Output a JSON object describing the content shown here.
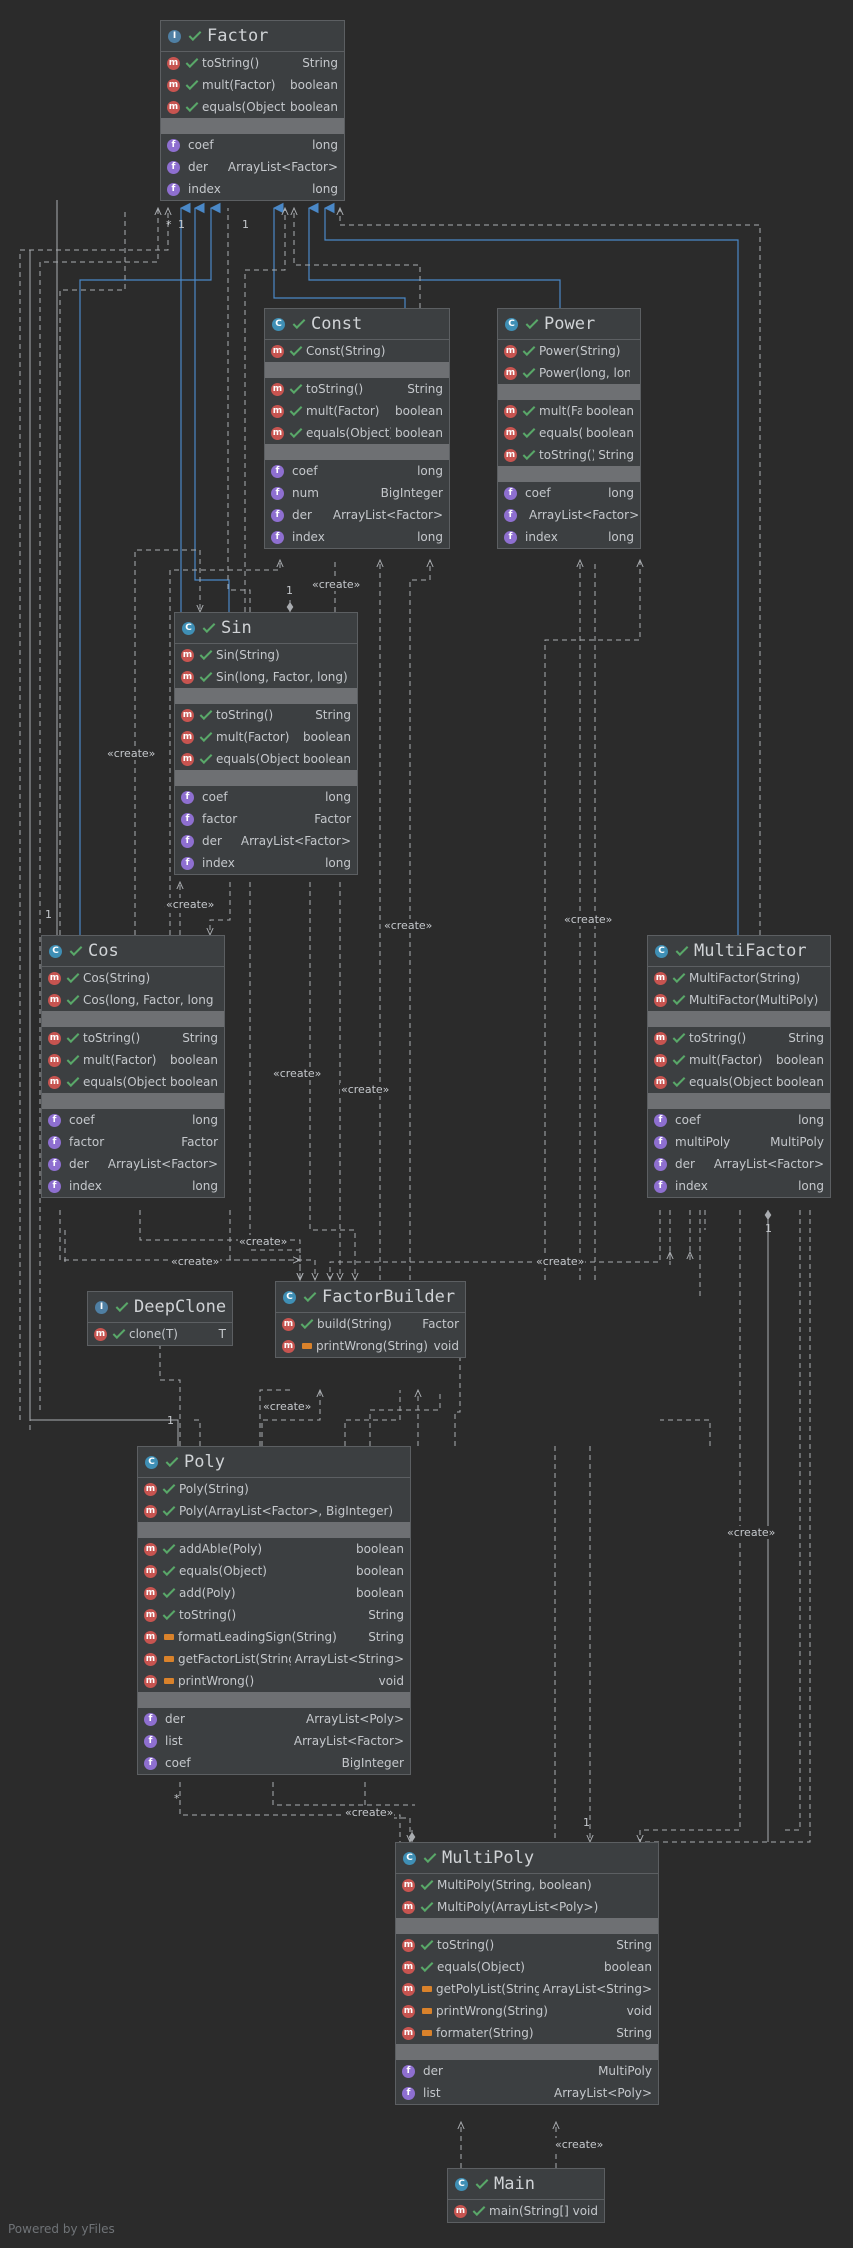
{
  "classes": [
    {
      "id": "factor",
      "name": "Factor",
      "kind": "i",
      "methods": [
        {
          "b": "m",
          "v": "pub",
          "n": "toString()",
          "t": "String",
          "abstract": true
        },
        {
          "b": "m",
          "v": "pub",
          "n": "mult(Factor)",
          "t": "boolean",
          "abstract": true
        },
        {
          "b": "m",
          "v": "pub",
          "n": "equals(Object)",
          "t": "boolean",
          "abstract": true
        }
      ],
      "fields": [
        {
          "b": "f",
          "v": "none",
          "n": "coef",
          "t": "long"
        },
        {
          "b": "f",
          "v": "none",
          "n": "der",
          "t": "ArrayList<Factor>"
        },
        {
          "b": "f",
          "v": "none",
          "n": "index",
          "t": "long"
        }
      ]
    },
    {
      "id": "const",
      "name": "Const",
      "kind": "c",
      "ctors": [
        {
          "b": "m",
          "v": "pub",
          "n": "Const(String)",
          "t": ""
        }
      ],
      "methods": [
        {
          "b": "m",
          "v": "pub",
          "n": "toString()",
          "t": "String"
        },
        {
          "b": "m",
          "v": "pub",
          "n": "mult(Factor)",
          "t": "boolean"
        },
        {
          "b": "m",
          "v": "pub",
          "n": "equals(Object)",
          "t": "boolean"
        }
      ],
      "fields": [
        {
          "b": "f",
          "v": "none",
          "n": "coef",
          "t": "long"
        },
        {
          "b": "f",
          "v": "none",
          "n": "num",
          "t": "BigInteger"
        },
        {
          "b": "f",
          "v": "none",
          "n": "der",
          "t": "ArrayList<Factor>"
        },
        {
          "b": "f",
          "v": "none",
          "n": "index",
          "t": "long"
        }
      ]
    },
    {
      "id": "power",
      "name": "Power",
      "kind": "c",
      "ctors": [
        {
          "b": "m",
          "v": "pub",
          "n": "Power(String)",
          "t": ""
        },
        {
          "b": "m",
          "v": "pub",
          "n": "Power(long, long)",
          "t": ""
        }
      ],
      "methods": [
        {
          "b": "m",
          "v": "pub",
          "n": "mult(Factor)",
          "t": "boolean"
        },
        {
          "b": "m",
          "v": "pub",
          "n": "equals(Object)",
          "t": "boolean"
        },
        {
          "b": "m",
          "v": "pub",
          "n": "toString()",
          "t": "String"
        }
      ],
      "fields": [
        {
          "b": "f",
          "v": "none",
          "n": "coef",
          "t": "long"
        },
        {
          "b": "f",
          "v": "none",
          "n": "der",
          "t": "ArrayList<Factor>"
        },
        {
          "b": "f",
          "v": "none",
          "n": "index",
          "t": "long"
        }
      ]
    },
    {
      "id": "sin",
      "name": "Sin",
      "kind": "c",
      "ctors": [
        {
          "b": "m",
          "v": "pub",
          "n": "Sin(String)",
          "t": ""
        },
        {
          "b": "m",
          "v": "pub",
          "n": "Sin(long, Factor, long)",
          "t": ""
        }
      ],
      "methods": [
        {
          "b": "m",
          "v": "pub",
          "n": "toString()",
          "t": "String"
        },
        {
          "b": "m",
          "v": "pub",
          "n": "mult(Factor)",
          "t": "boolean"
        },
        {
          "b": "m",
          "v": "pub",
          "n": "equals(Object)",
          "t": "boolean"
        }
      ],
      "fields": [
        {
          "b": "f",
          "v": "none",
          "n": "coef",
          "t": "long"
        },
        {
          "b": "f",
          "v": "none",
          "n": "factor",
          "t": "Factor"
        },
        {
          "b": "f",
          "v": "none",
          "n": "der",
          "t": "ArrayList<Factor>"
        },
        {
          "b": "f",
          "v": "none",
          "n": "index",
          "t": "long"
        }
      ]
    },
    {
      "id": "cos",
      "name": "Cos",
      "kind": "c",
      "ctors": [
        {
          "b": "m",
          "v": "pub",
          "n": "Cos(String)",
          "t": ""
        },
        {
          "b": "m",
          "v": "pub",
          "n": "Cos(long, Factor, long)",
          "t": ""
        }
      ],
      "methods": [
        {
          "b": "m",
          "v": "pub",
          "n": "toString()",
          "t": "String"
        },
        {
          "b": "m",
          "v": "pub",
          "n": "mult(Factor)",
          "t": "boolean"
        },
        {
          "b": "m",
          "v": "pub",
          "n": "equals(Object)",
          "t": "boolean"
        }
      ],
      "fields": [
        {
          "b": "f",
          "v": "none",
          "n": "coef",
          "t": "long"
        },
        {
          "b": "f",
          "v": "none",
          "n": "factor",
          "t": "Factor"
        },
        {
          "b": "f",
          "v": "none",
          "n": "der",
          "t": "ArrayList<Factor>"
        },
        {
          "b": "f",
          "v": "none",
          "n": "index",
          "t": "long"
        }
      ]
    },
    {
      "id": "multifactor",
      "name": "MultiFactor",
      "kind": "c",
      "ctors": [
        {
          "b": "m",
          "v": "pub",
          "n": "MultiFactor(String)",
          "t": ""
        },
        {
          "b": "m",
          "v": "pub",
          "n": "MultiFactor(MultiPoly)",
          "t": ""
        }
      ],
      "methods": [
        {
          "b": "m",
          "v": "pub",
          "n": "toString()",
          "t": "String"
        },
        {
          "b": "m",
          "v": "pub",
          "n": "mult(Factor)",
          "t": "boolean"
        },
        {
          "b": "m",
          "v": "pub",
          "n": "equals(Object)",
          "t": "boolean"
        }
      ],
      "fields": [
        {
          "b": "f",
          "v": "none",
          "n": "coef",
          "t": "long"
        },
        {
          "b": "f",
          "v": "none",
          "n": "multiPoly",
          "t": "MultiPoly"
        },
        {
          "b": "f",
          "v": "none",
          "n": "der",
          "t": "ArrayList<Factor>"
        },
        {
          "b": "f",
          "v": "none",
          "n": "index",
          "t": "long"
        }
      ]
    },
    {
      "id": "deepclone",
      "name": "DeepClone",
      "kind": "i",
      "methods": [
        {
          "b": "m",
          "v": "pub",
          "n": "clone(T)",
          "t": "T",
          "abstract": true
        }
      ]
    },
    {
      "id": "factorbuilder",
      "name": "FactorBuilder",
      "kind": "c",
      "methods": [
        {
          "b": "m",
          "v": "pub",
          "n": "build(String)",
          "t": "Factor"
        },
        {
          "b": "m",
          "v": "priv",
          "n": "printWrong(String)",
          "t": "void"
        }
      ]
    },
    {
      "id": "poly",
      "name": "Poly",
      "kind": "c",
      "ctors": [
        {
          "b": "m",
          "v": "pub",
          "n": "Poly(String)",
          "t": ""
        },
        {
          "b": "m",
          "v": "pub",
          "n": "Poly(ArrayList<Factor>, BigInteger)",
          "t": ""
        }
      ],
      "methods": [
        {
          "b": "m",
          "v": "pub",
          "n": "addAble(Poly)",
          "t": "boolean"
        },
        {
          "b": "m",
          "v": "pub",
          "n": "equals(Object)",
          "t": "boolean"
        },
        {
          "b": "m",
          "v": "pub",
          "n": "add(Poly)",
          "t": "boolean"
        },
        {
          "b": "m",
          "v": "pub",
          "n": "toString()",
          "t": "String"
        },
        {
          "b": "m",
          "v": "priv",
          "n": "formatLeadingSign(String)",
          "t": "String"
        },
        {
          "b": "m",
          "v": "priv",
          "n": "getFactorList(String)",
          "t": "ArrayList<String>"
        },
        {
          "b": "m",
          "v": "priv",
          "n": "printWrong()",
          "t": "void"
        }
      ],
      "fields": [
        {
          "b": "f",
          "v": "none",
          "n": "der",
          "t": "ArrayList<Poly>"
        },
        {
          "b": "f",
          "v": "none",
          "n": "list",
          "t": "ArrayList<Factor>"
        },
        {
          "b": "f",
          "v": "none",
          "n": "coef",
          "t": "BigInteger"
        }
      ]
    },
    {
      "id": "multipoly",
      "name": "MultiPoly",
      "kind": "c",
      "ctors": [
        {
          "b": "m",
          "v": "pub",
          "n": "MultiPoly(String, boolean)",
          "t": ""
        },
        {
          "b": "m",
          "v": "pub",
          "n": "MultiPoly(ArrayList<Poly>)",
          "t": ""
        }
      ],
      "methods": [
        {
          "b": "m",
          "v": "pub",
          "n": "toString()",
          "t": "String"
        },
        {
          "b": "m",
          "v": "pub",
          "n": "equals(Object)",
          "t": "boolean"
        },
        {
          "b": "m",
          "v": "priv",
          "n": "getPolyList(String)",
          "t": "ArrayList<String>"
        },
        {
          "b": "m",
          "v": "priv",
          "n": "printWrong(String)",
          "t": "void"
        },
        {
          "b": "m",
          "v": "priv",
          "n": "formater(String)",
          "t": "String"
        }
      ],
      "fields": [
        {
          "b": "f",
          "v": "none",
          "n": "der",
          "t": "MultiPoly"
        },
        {
          "b": "f",
          "v": "none",
          "n": "list",
          "t": "ArrayList<Poly>"
        }
      ]
    },
    {
      "id": "main",
      "name": "Main",
      "kind": "c",
      "methods": [
        {
          "b": "m",
          "v": "pub",
          "n": "main(String[])",
          "t": "void",
          "static": true
        }
      ]
    }
  ],
  "edge_label": "«create»",
  "multiplicities": {
    "one": "1",
    "many": "*"
  },
  "footer": "Powered by yFiles",
  "colors": {
    "background": "#2b2b2b",
    "node": "#3c3f41",
    "separator": "#6e7073",
    "implements": "#4a88c7",
    "dashed": "#a9acb0"
  }
}
